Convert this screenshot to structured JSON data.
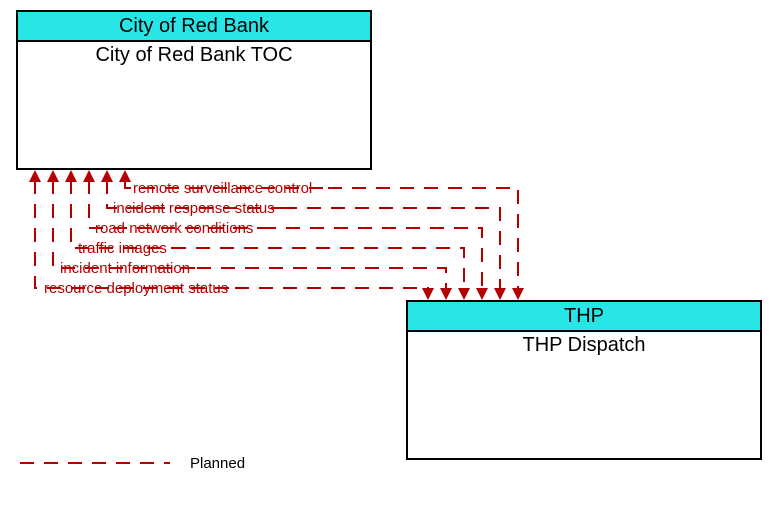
{
  "boxes": {
    "left": {
      "header": "City of Red Bank",
      "sub": "City of Red Bank TOC"
    },
    "right": {
      "header": "THP",
      "sub": "THP Dispatch"
    }
  },
  "flows": {
    "f0": "remote surveillance control",
    "f1": "incident response status",
    "f2": "road network conditions",
    "f3": "traffic images",
    "f4": "incident information",
    "f5": "resource deployment status"
  },
  "legend": {
    "planned": "Planned"
  }
}
